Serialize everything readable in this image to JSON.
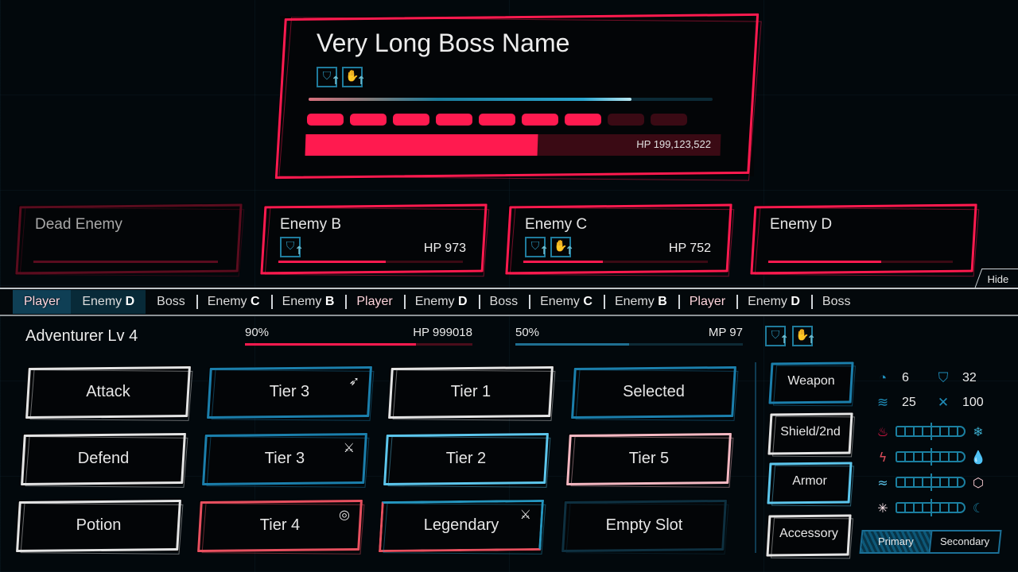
{
  "boss": {
    "name": "Very Long Boss Name",
    "buffs": [
      {
        "icon": "shield-up-icon",
        "glyph": "⛉"
      },
      {
        "icon": "claw-up-icon",
        "glyph": "✋"
      }
    ],
    "shield_percent": 80,
    "hp_segments_total": 9,
    "hp_segments_filled": 7,
    "hp_percent": 56,
    "hp_text": "HP 199,123,522",
    "color": "#ff1a4f"
  },
  "enemies": [
    {
      "name": "Dead Enemy",
      "hp_text": "",
      "hp_percent": 100,
      "dead": true,
      "buffs": []
    },
    {
      "name": "Enemy B",
      "hp_text": "HP 973",
      "hp_percent": 58,
      "buffs": [
        {
          "icon": "shield-up-icon",
          "glyph": "⛉"
        }
      ]
    },
    {
      "name": "Enemy C",
      "hp_text": "HP 752",
      "hp_percent": 43,
      "buffs": [
        {
          "icon": "shield-up-icon",
          "glyph": "⛉"
        },
        {
          "icon": "claw-up-icon",
          "glyph": "✋"
        }
      ]
    },
    {
      "name": "Enemy D",
      "hp_text": "",
      "hp_percent": 61,
      "buffs": []
    }
  ],
  "hide_label": "Hide",
  "turn_order": [
    {
      "name": "Player",
      "suffix": ""
    },
    {
      "name": "Enemy ",
      "suffix": "D"
    },
    {
      "name": "Boss",
      "suffix": ""
    },
    {
      "name": "Enemy ",
      "suffix": "C"
    },
    {
      "name": "Enemy ",
      "suffix": "B"
    },
    {
      "name": "Player",
      "suffix": ""
    },
    {
      "name": "Enemy ",
      "suffix": "D"
    },
    {
      "name": "Boss",
      "suffix": ""
    },
    {
      "name": "Enemy ",
      "suffix": "C"
    },
    {
      "name": "Enemy ",
      "suffix": "B"
    },
    {
      "name": "Player",
      "suffix": ""
    },
    {
      "name": "Enemy ",
      "suffix": "D"
    },
    {
      "name": "Boss",
      "suffix": ""
    }
  ],
  "player": {
    "name": "Adventurer Lv 4",
    "hp_percent_label": "90%",
    "hp_percent": 75,
    "hp_text": "HP 999018",
    "mp_percent_label": "50%",
    "mp_percent": 50,
    "mp_text": "MP 97",
    "buffs": [
      {
        "icon": "shield-up-icon",
        "glyph": "⛉"
      },
      {
        "icon": "claw-up-icon",
        "glyph": "✋"
      }
    ]
  },
  "actions": [
    {
      "label": "Attack",
      "style": "white",
      "corner": ""
    },
    {
      "label": "Tier 3",
      "style": "blue",
      "corner": "➶"
    },
    {
      "label": "Tier 1",
      "style": "white",
      "corner": ""
    },
    {
      "label": "Selected",
      "style": "blue",
      "corner": ""
    },
    {
      "label": "Defend",
      "style": "white",
      "corner": ""
    },
    {
      "label": "Tier 3",
      "style": "blue",
      "corner": "⚔"
    },
    {
      "label": "Tier 2",
      "style": "lightblue",
      "corner": ""
    },
    {
      "label": "Tier 5",
      "style": "pink",
      "corner": ""
    },
    {
      "label": "Potion",
      "style": "white",
      "corner": ""
    },
    {
      "label": "Tier 4",
      "style": "red",
      "corner": "◎"
    },
    {
      "label": "Legendary",
      "style": "legend",
      "corner": "⚔"
    },
    {
      "label": "Empty Slot",
      "style": "empty",
      "corner": ""
    }
  ],
  "equipment": [
    {
      "label": "Weapon",
      "style": "blue"
    },
    {
      "label": "Shield/2nd",
      "style": "white"
    },
    {
      "label": "Armor",
      "style": "lightblue"
    },
    {
      "label": "Accessory",
      "style": "white"
    }
  ],
  "stats": [
    {
      "icon": "magic-icon",
      "glyph": "◔",
      "value": "6"
    },
    {
      "icon": "defense-icon",
      "glyph": "⛉",
      "value": "32"
    },
    {
      "icon": "speed-icon",
      "glyph": "≋",
      "value": "25"
    },
    {
      "icon": "crit-icon",
      "glyph": "✕",
      "value": "100"
    }
  ],
  "resistances": [
    {
      "left_icon": "fire-icon",
      "left_glyph": "♨",
      "left_color": "#ff1a4f",
      "right_icon": "ice-icon",
      "right_glyph": "❄",
      "right_color": "#3aa8c8"
    },
    {
      "left_icon": "lightning-icon",
      "left_glyph": "ϟ",
      "left_color": "#e8505f",
      "right_icon": "water-icon",
      "right_glyph": "💧",
      "right_color": "#1b6f96"
    },
    {
      "left_icon": "wind-icon",
      "left_glyph": "≈",
      "left_color": "#5cc6ec",
      "right_icon": "earth-icon",
      "right_glyph": "⬡",
      "right_color": "#f5c8cf"
    },
    {
      "left_icon": "light-icon",
      "left_glyph": "✳",
      "left_color": "#fbe4ea",
      "right_icon": "dark-icon",
      "right_glyph": "☾",
      "right_color": "#1b7fa0"
    }
  ],
  "weapon_slot_toggle": {
    "primary": "Primary",
    "secondary": "Secondary",
    "selected": "primary"
  }
}
